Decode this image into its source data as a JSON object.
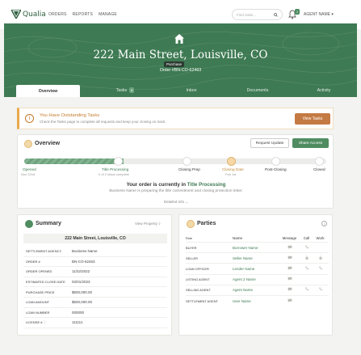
{
  "nav": {
    "logo_text": "Qualia",
    "links": [
      "ORDERS",
      "REPORTS",
      "MANAGE"
    ],
    "search_placeholder": "Find order...",
    "notification_count": "2",
    "user_label": "AGENT NAME"
  },
  "order": {
    "address": "222 Main Street, Louisville, CO",
    "purpose": "Purchase",
    "order_number": "Order #BN-CO-62463"
  },
  "tabs": [
    {
      "label": "Overview",
      "badge": ""
    },
    {
      "label": "Tasks",
      "badge": "8"
    },
    {
      "label": "Inbox",
      "badge": ""
    },
    {
      "label": "Documents",
      "badge": ""
    },
    {
      "label": "Activity",
      "badge": ""
    }
  ],
  "alert": {
    "title": "You Have Outstanding Tasks",
    "subtitle": "Check the Tasks page to complete all requests and keep your closing on track.",
    "button": "View Tasks"
  },
  "overview": {
    "title": "Overview",
    "request_update": "Request Update",
    "share_access": "Share Access",
    "progress": 0.33,
    "milestones": [
      {
        "label": "Opened",
        "sub": "Nov 22nd"
      },
      {
        "label": "Title Processing",
        "sub": "0 of 2 steps complete"
      },
      {
        "label": "Closing Prep",
        "sub": ""
      },
      {
        "label": "Closing Date",
        "sub": "Feb 1st"
      },
      {
        "label": "Post-Closing",
        "sub": ""
      },
      {
        "label": "Closed",
        "sub": ""
      }
    ],
    "status_prefix": "Your order is currently in ",
    "status_stage": "Title Processing",
    "status_detail": "Business Name is preparing the title commitment and closing protection letter.",
    "details_link": "Detailed Info"
  },
  "summary": {
    "title": "Summary",
    "view_property": "View Property",
    "header": "222 Main Street, Louisville, CO",
    "rows": [
      {
        "k": "SETTLEMENT AGENCY",
        "v": "Business Name"
      },
      {
        "k": "ORDER #",
        "v": "BN-CO-62463"
      },
      {
        "k": "ORDER OPENED",
        "v": "11/22/2022"
      },
      {
        "k": "ESTIMATED CLOSE DATE",
        "v": "02/01/2023"
      },
      {
        "k": "PURCHASE PRICE",
        "v": "$500,000.00"
      },
      {
        "k": "LOAN AMOUNT",
        "v": "$500,000.00"
      },
      {
        "k": "LOAN NUMBER",
        "v": "000000"
      },
      {
        "k": "LICENSE #",
        "v": "111111"
      }
    ]
  },
  "parties": {
    "title": "Parties",
    "headers": [
      "Role",
      "Name",
      "Message",
      "Call",
      "Work"
    ],
    "rows": [
      {
        "role": "BUYER",
        "name": "Borrower Name"
      },
      {
        "role": "SELLER",
        "name": "Seller Name"
      },
      {
        "role": "LOAN OFFICER",
        "name": "Lender Name"
      },
      {
        "role": "LISTING AGENT",
        "name": "Agent 2 Name"
      },
      {
        "role": "SELLING AGENT",
        "name": "Agent Name"
      },
      {
        "role": "SETTLEMENT AGENT",
        "name": "User Name"
      }
    ]
  },
  "colors": {
    "brand_green": "#3e7a53",
    "accent_orange": "#c47a43",
    "link_green": "#3d7a52"
  }
}
